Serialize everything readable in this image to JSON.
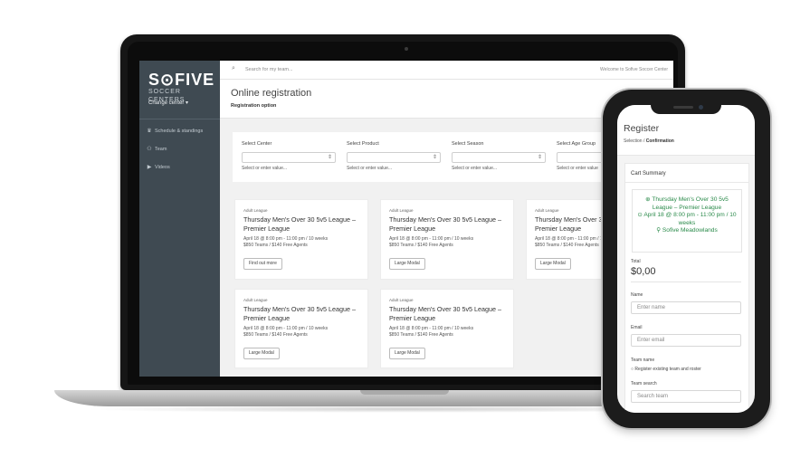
{
  "laptop": {
    "sidebar": {
      "brand_top": "S⊙FIVE",
      "brand_sub": "SOCCER CENTERS",
      "change_center": "Change center ▾",
      "nav": [
        {
          "icon": "trophy-icon",
          "glyph": "🏆",
          "label": "Schedule & standings"
        },
        {
          "icon": "team-icon",
          "glyph": "👥",
          "label": "Team"
        },
        {
          "icon": "video-icon",
          "glyph": "▶",
          "label": "Videos"
        }
      ]
    },
    "topbar": {
      "search_placeholder": "Search for my team...",
      "welcome": "Welcome to Sofive Soccer Center"
    },
    "page": {
      "title": "Online registration",
      "subtitle": "Registration option"
    },
    "filters": [
      {
        "label": "Select Center",
        "hint": "Select or enter value..."
      },
      {
        "label": "Select Product",
        "hint": "Select or enter value..."
      },
      {
        "label": "Select Season",
        "hint": "Select or enter value..."
      },
      {
        "label": "Select Age Group",
        "hint": "Select or enter value"
      }
    ],
    "cards": [
      {
        "kicker": "Adult League",
        "title": "Thursday Men's Over 30 5v5 League – Premier League",
        "meta1": "April 18 @ 8:00 pm - 11:00 pm / 10 weeks",
        "meta2": "$850 Teams / $140 Free Agents",
        "button": "Find out more"
      },
      {
        "kicker": "Adult League",
        "title": "Thursday Men's Over 30 5v5 League – Premier League",
        "meta1": "April 18 @ 8:00 pm - 11:00 pm / 10 weeks",
        "meta2": "$850 Teams / $140 Free Agents",
        "button": "Large Modal"
      },
      {
        "kicker": "Adult League",
        "title": "Thursday Men's Over 30 5v5 League – Premier League",
        "meta1": "April 18 @ 8:00 pm - 11:00 pm / 10 weeks",
        "meta2": "$850 Teams / $140 Free Agents",
        "button": "Large Modal"
      },
      {
        "kicker": "Adult League",
        "title": "Thursday Men's Over 30 5v5 League – Premier League",
        "meta1": "April 18 @ 8:00 pm - 11:00 pm / 10 weeks",
        "meta2": "$850 Teams / $140 Free Agents",
        "button": "Large Modal"
      },
      {
        "kicker": "Adult League",
        "title": "Thursday Men's Over 30 5v5 League – Premier League",
        "meta1": "April 18 @ 8:00 pm - 11:00 pm / 10 weeks",
        "meta2": "$850 Teams / $140 Free Agents",
        "button": "Large Modal"
      }
    ]
  },
  "phone": {
    "title": "Register",
    "crumb_prefix": "Selection /",
    "crumb_current": "Confirmation",
    "cart_title": "Cart Summary",
    "event_line1": "⊕ Thursday Men's Over 30 5v5 League – Premier League",
    "event_line2": "⊙ April 18 @ 8:00 pm - 11:00 pm / 10 weeks",
    "event_line3": "⚲ Sofive Meadowlands",
    "total_label": "Total",
    "total_value": "$0,00",
    "name_label": "Name",
    "name_placeholder": "Enter name",
    "email_label": "Email",
    "email_placeholder": "Enter email",
    "team_name_label": "Team name",
    "team_radio": "Register existing team and roster",
    "team_search_label": "Team search",
    "team_search_placeholder": "Search team"
  },
  "colors": {
    "sidebar": "#3f4a52",
    "accent_green": "#2a8a4a"
  }
}
